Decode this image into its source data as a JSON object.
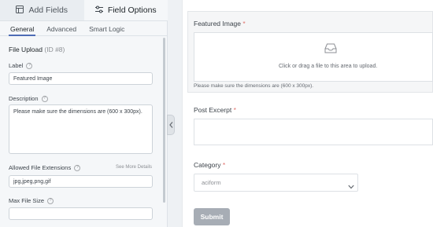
{
  "sidebar": {
    "tabs": [
      {
        "label": "Add Fields",
        "icon": "grid-plus-icon"
      },
      {
        "label": "Field Options",
        "icon": "sliders-icon"
      }
    ],
    "sub_tabs": [
      "General",
      "Advanced",
      "Smart Logic"
    ],
    "field_type": "File Upload",
    "field_id": "(ID #8)",
    "label_caption": "Label",
    "label_value": "Featured Image",
    "description_caption": "Description",
    "description_value": "Please make sure the dimensions are (600 x 300px).",
    "extensions_caption": "Allowed File Extensions",
    "see_more": "See More Details",
    "extensions_value": "jpg,jpeg,png,gif",
    "max_size_caption": "Max File Size",
    "max_size_value": ""
  },
  "form": {
    "featured_label": "Featured Image",
    "required_mark": "*",
    "dropzone_text": "Click or drag a file to this area to upload.",
    "dimension_note": "Please make sure the dimensions are (600 x 300px).",
    "excerpt_label": "Post Excerpt",
    "category_label": "Category",
    "category_value": "aciform",
    "submit_label": "Submit"
  },
  "colors": {
    "accent": "#4e6cb5",
    "required": "#e0726c",
    "submit_bg": "#a7adb5"
  }
}
